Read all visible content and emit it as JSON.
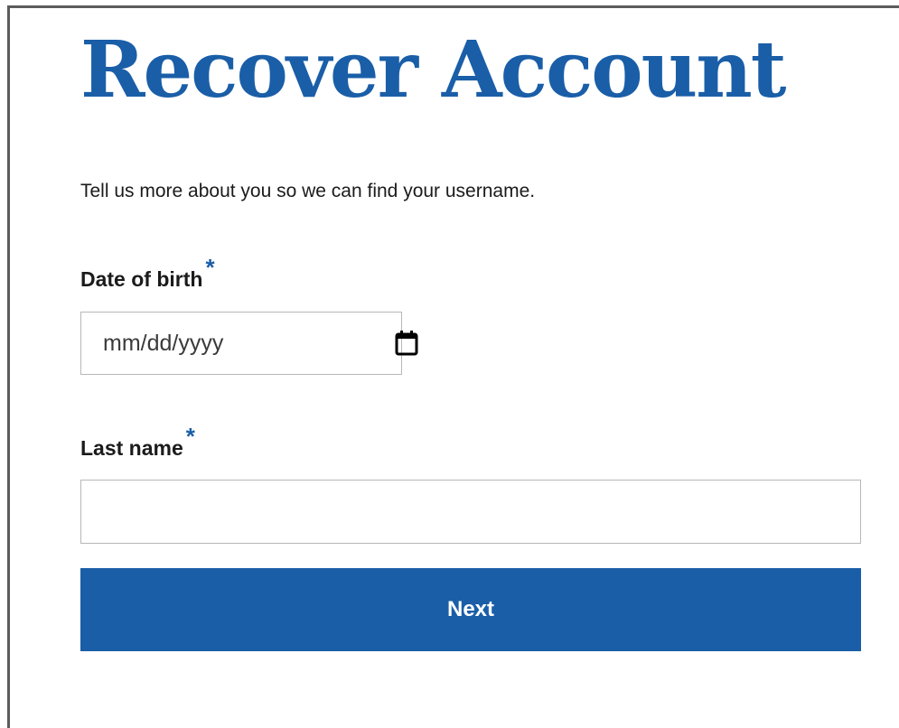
{
  "page": {
    "title": "Recover Account",
    "intro": "Tell us more about you so we can find your username."
  },
  "form": {
    "dob": {
      "label": "Date of birth",
      "required_marker": "*",
      "placeholder": "mm/dd/yyyy",
      "value": "",
      "icon": "calendar-icon"
    },
    "last_name": {
      "label": "Last name",
      "required_marker": "*",
      "value": "",
      "placeholder": ""
    },
    "submit_label": "Next"
  },
  "colors": {
    "accent": "#1a5ea8",
    "text": "#1b1b1b",
    "border": "#b7b7b7",
    "frame_border": "#5c5c5c"
  }
}
